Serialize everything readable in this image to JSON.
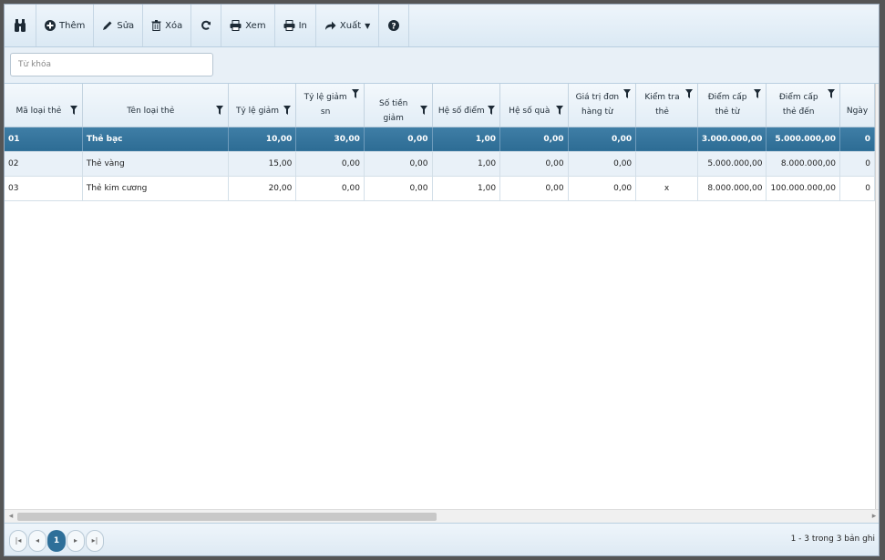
{
  "toolbar": {
    "items": [
      {
        "name": "find-button",
        "icon": "binoculars-icon",
        "label": ""
      },
      {
        "name": "add-button",
        "icon": "plus-circle-icon",
        "label": "Thêm"
      },
      {
        "name": "edit-button",
        "icon": "pencil-icon",
        "label": "Sửa"
      },
      {
        "name": "delete-button",
        "icon": "trash-icon",
        "label": "Xóa"
      },
      {
        "name": "refresh-button",
        "icon": "refresh-icon",
        "label": ""
      },
      {
        "name": "preview-button",
        "icon": "print-preview-icon",
        "label": "Xem"
      },
      {
        "name": "print-button",
        "icon": "printer-icon",
        "label": "In"
      },
      {
        "name": "export-button",
        "icon": "share-arrow-icon",
        "label": "Xuất"
      },
      {
        "name": "help-button",
        "icon": "question-icon",
        "label": ""
      }
    ]
  },
  "search": {
    "placeholder": "Từ khóa",
    "value": ""
  },
  "grid": {
    "columns": [
      {
        "label": "Mã loại thẻ"
      },
      {
        "label": "Tên loại thẻ"
      },
      {
        "label": "Tỷ lệ giảm"
      },
      {
        "label": "Tỷ lệ giảm\nsn"
      },
      {
        "label": "Số tiền giảm"
      },
      {
        "label": "Hệ số điểm"
      },
      {
        "label": "Hệ số quà"
      },
      {
        "label": "Giá trị đơn\nhàng từ"
      },
      {
        "label": "Kiểm tra\nthẻ"
      },
      {
        "label": "Điểm cấp\nthẻ từ"
      },
      {
        "label": "Điểm cấp\nthẻ đến"
      },
      {
        "label": "Ngày"
      }
    ],
    "rows": [
      {
        "cells": [
          "01",
          "Thẻ bạc",
          "10,00",
          "30,00",
          "0,00",
          "1,00",
          "0,00",
          "0,00",
          "",
          "3.000.000,00",
          "5.000.000,00",
          "0"
        ],
        "selected": true
      },
      {
        "cells": [
          "02",
          "Thẻ vàng",
          "15,00",
          "0,00",
          "0,00",
          "1,00",
          "0,00",
          "0,00",
          "",
          "5.000.000,00",
          "8.000.000,00",
          "0"
        ],
        "selected": false
      },
      {
        "cells": [
          "03",
          "Thẻ kim cương",
          "20,00",
          "0,00",
          "0,00",
          "1,00",
          "0,00",
          "0,00",
          "x",
          "8.000.000,00",
          "100.000.000,00",
          "0"
        ],
        "selected": false
      }
    ]
  },
  "pager": {
    "current_page": "1",
    "info": "1 - 3 trong 3 bản ghi"
  },
  "colors": {
    "selected_row": "#2d6c94",
    "alt_row": "#e9f1f8",
    "toolbar_bg": "#dbe9f4"
  }
}
